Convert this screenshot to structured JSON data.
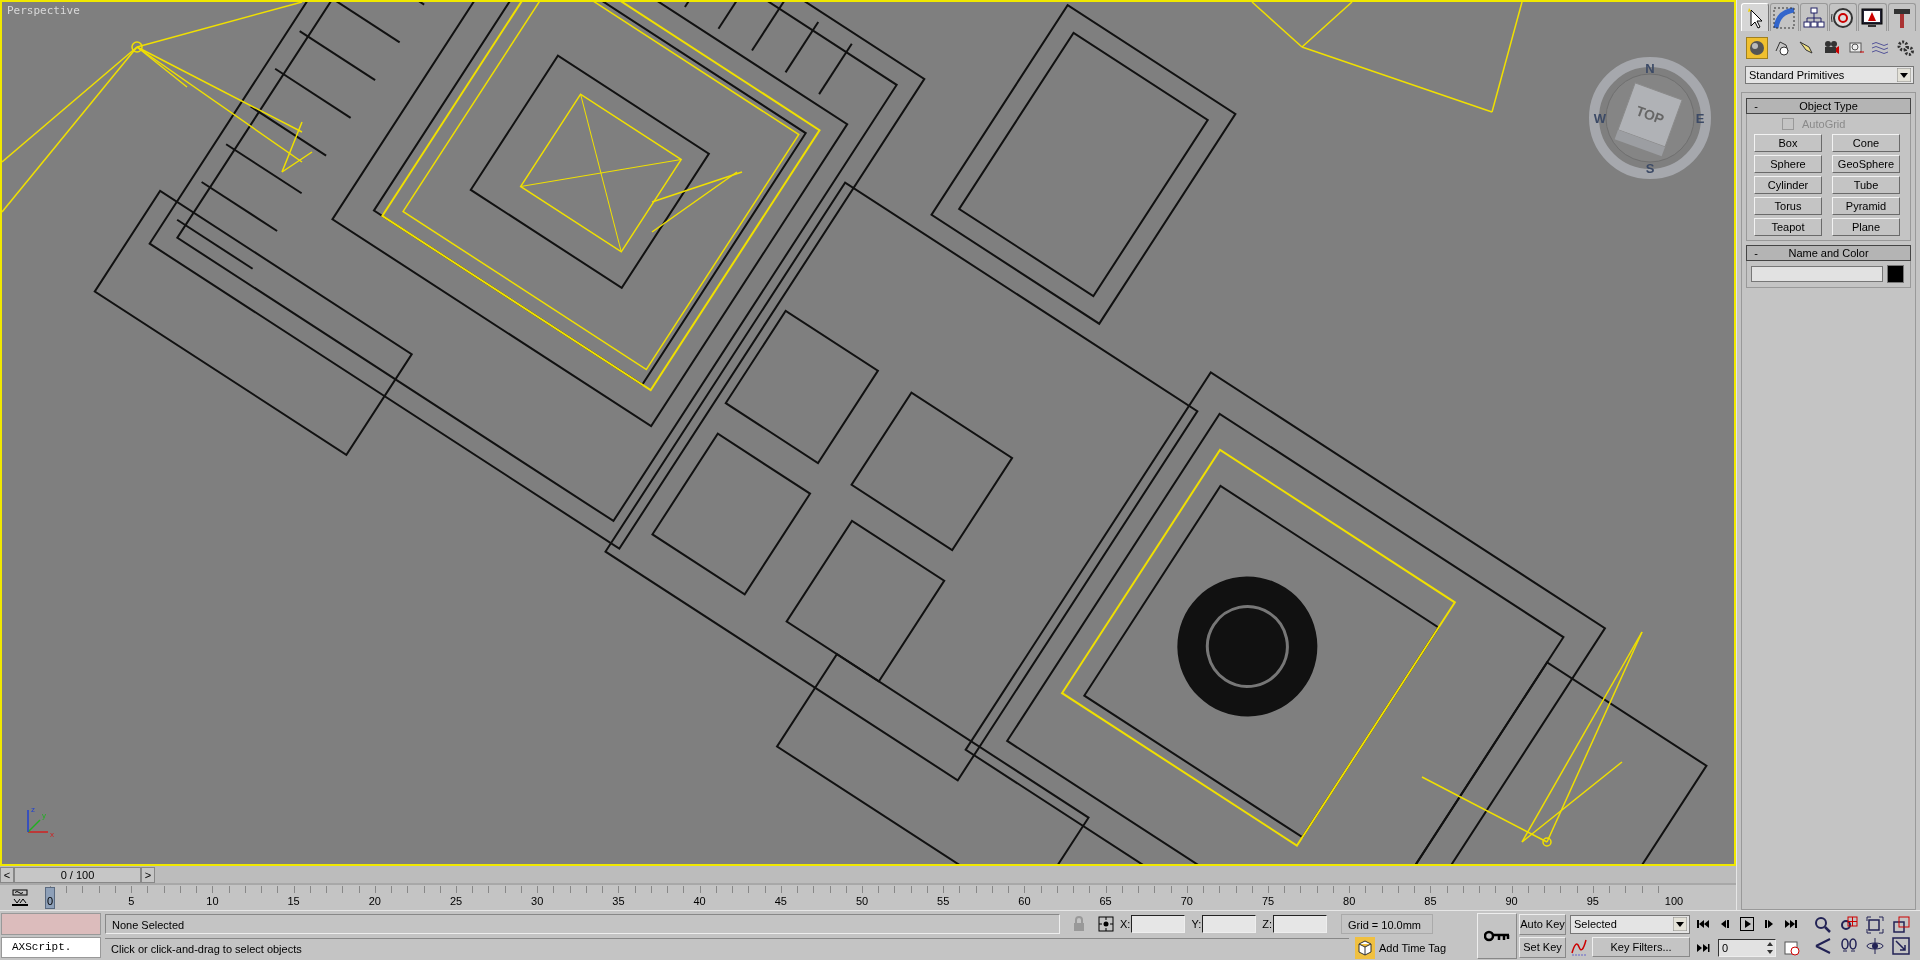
{
  "viewport": {
    "label": "Perspective",
    "viewcube": {
      "face": "TOP",
      "compass": [
        "N",
        "E",
        "S",
        "W"
      ]
    },
    "axis_labels": [
      "x",
      "y",
      "z"
    ]
  },
  "command_panel": {
    "tabs": [
      {
        "selected": true
      },
      {
        "selected": false
      },
      {
        "selected": false
      },
      {
        "selected": false
      },
      {
        "selected": false
      },
      {
        "selected": false
      }
    ],
    "categories": [
      {
        "selected": true
      },
      {
        "selected": false
      },
      {
        "selected": false
      },
      {
        "selected": false
      },
      {
        "selected": false
      },
      {
        "selected": false
      },
      {
        "selected": false
      }
    ],
    "dropdown": "Standard Primitives",
    "object_type": {
      "toggle": "-",
      "title": "Object Type",
      "autogrid": {
        "label": "AutoGrid",
        "checked": false,
        "disabled": true
      },
      "buttons": [
        "Box",
        "Cone",
        "Sphere",
        "GeoSphere",
        "Cylinder",
        "Tube",
        "Torus",
        "Pyramid",
        "Teapot",
        "Plane"
      ]
    },
    "name_and_color": {
      "toggle": "-",
      "title": "Name and Color",
      "color": "#000000"
    }
  },
  "time_slider": {
    "prev": "<",
    "label": "0 / 100",
    "next": ">",
    "level": 0
  },
  "trackbar": {
    "level": 0,
    "ticks": [
      "0",
      "5",
      "10",
      "15",
      "20",
      "25",
      "30",
      "35",
      "40",
      "45",
      "50",
      "55",
      "60",
      "65",
      "70",
      "75",
      "80",
      "85",
      "90",
      "95",
      "100"
    ]
  },
  "status": {
    "listener_value": "AXScript.",
    "selection": "None Selected",
    "prompt": "Click or click-and-drag to select objects",
    "coords": [
      {
        "axis": "X:"
      },
      {
        "axis": "Y:"
      },
      {
        "axis": "Z:"
      }
    ],
    "grid": "Grid = 10.0mm",
    "time_tag": "Add Time Tag",
    "auto_key": "Auto Key",
    "set_key": "Set Key",
    "selection_set": "Selected",
    "key_filters": "Key Filters...",
    "frame": "0"
  }
}
